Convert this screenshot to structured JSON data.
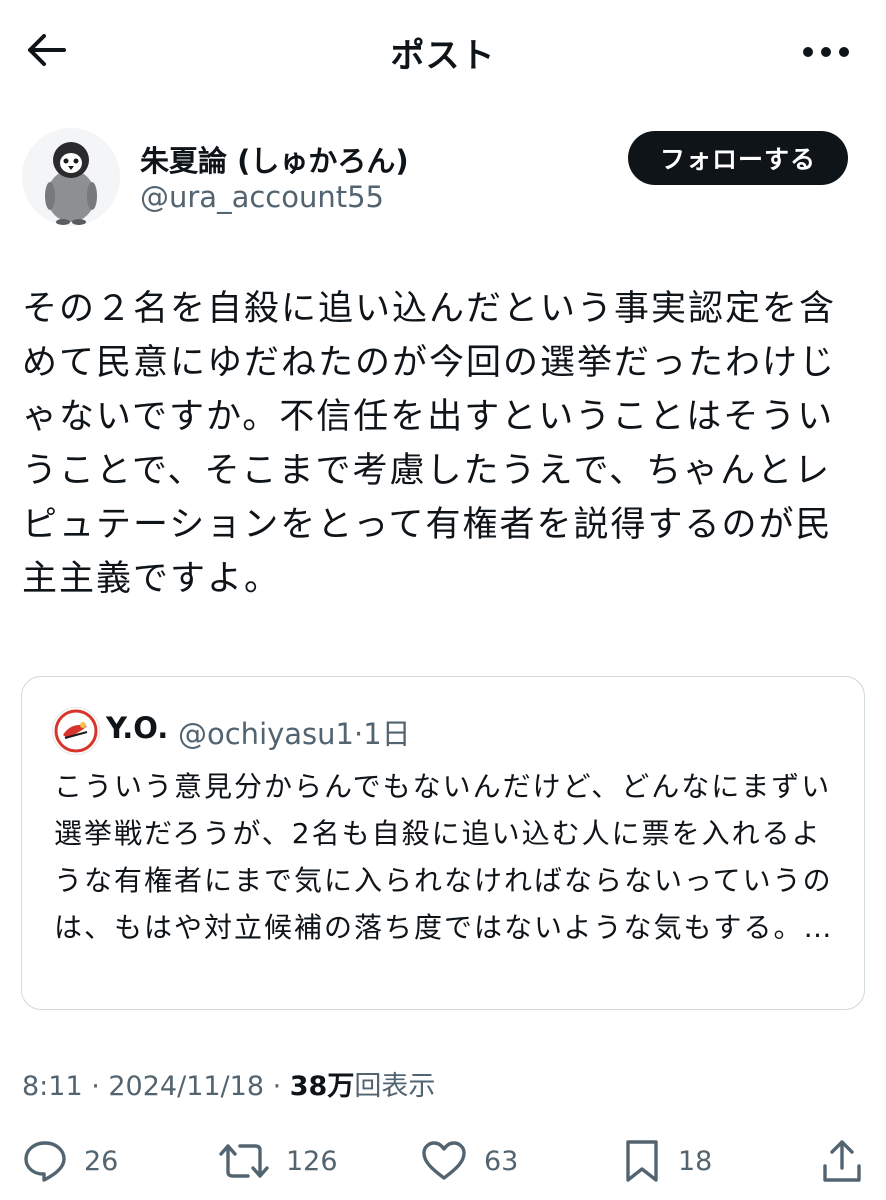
{
  "header": {
    "title": "ポスト",
    "back_icon": "arrow-left-icon",
    "more_icon": "more-horizontal-icon"
  },
  "author": {
    "display_name": "朱夏論 (しゅかろん)",
    "handle": "@ura_account55",
    "follow_label": "フォローする",
    "avatar_icon": "penguin-avatar"
  },
  "post": {
    "text": "その２名を自殺に追い込んだという事実認定を含めて民意にゆだねたのが今回の選挙だったわけじゃないですか。不信任を出すということはそういうことで、そこまで考慮したうえで、ちゃんとレピュテーションをとって有権者を説得するのが民主主義ですよ。"
  },
  "quote": {
    "name": "Y.O.",
    "handle_time": "@ochiyasu1·1日",
    "text": "こういう意見分からんでもないんだけど、どんなにまずい選挙戦だろうが、2名も自殺に追い込む人に票を入れるような有権者にまで気に入られなければならないっていうのは、もはや対立候補の落ち度ではないような気もする。…"
  },
  "meta": {
    "time_date": "8:11 · 2024/11/18 · ",
    "views_count": "38万",
    "views_label": "回表示"
  },
  "actions": {
    "reply": {
      "icon": "reply-icon",
      "count": "26"
    },
    "repost": {
      "icon": "repost-icon",
      "count": "126"
    },
    "like": {
      "icon": "heart-icon",
      "count": "63"
    },
    "bookmark": {
      "icon": "bookmark-icon",
      "count": "18"
    },
    "share": {
      "icon": "share-icon"
    }
  },
  "colors": {
    "text_primary": "#0f1419",
    "text_secondary": "#536471",
    "border": "#cfd9de",
    "follow_bg": "#0f1419"
  }
}
